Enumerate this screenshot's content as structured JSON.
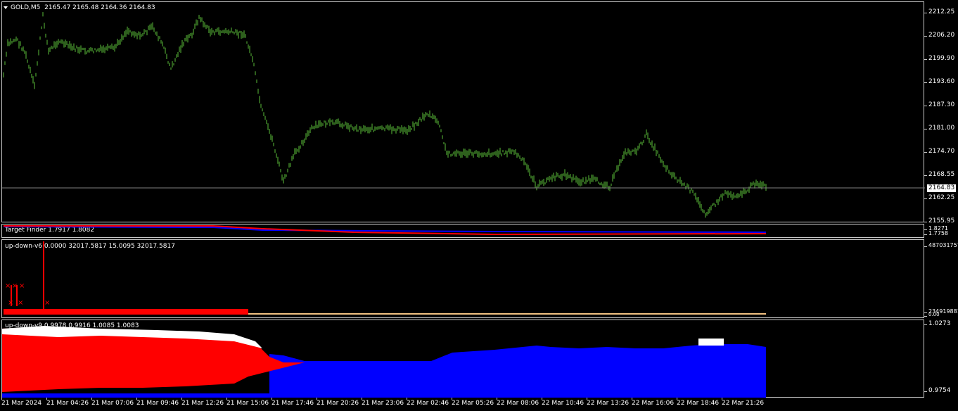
{
  "main": {
    "symbol_label": "GOLD,M5",
    "ohlc": "2165.47 2165.48 2164.36 2164.83",
    "price_tag": "2164.83",
    "price_ticks": [
      "2212.25",
      "2206.20",
      "2199.90",
      "2193.60",
      "2187.30",
      "2181.00",
      "2174.70",
      "2168.55",
      "2162.25",
      "2155.95"
    ],
    "colors": {
      "candles": "#5bbf3a",
      "bid_line": "#808080"
    }
  },
  "target_finder": {
    "label": "Target Finder 1.7917 1.8082",
    "ticks": [
      "1.8271",
      "1.7758"
    ],
    "colors": {
      "line_a": "#ff0000",
      "line_b": "#0000ff"
    }
  },
  "updown6": {
    "label": "up-down-v6 0.0000 32017.5817 15.0095 32017.5817",
    "ticks": [
      "487031757",
      "234919881",
      "0.00"
    ],
    "colors": {
      "signal": "#ff0000",
      "baseline": "#f0c080"
    }
  },
  "updown9": {
    "label": "up-down-v9 0.9978 0.9916 1.0085 1.0083",
    "ticks": [
      "1.0273",
      "0.9754"
    ],
    "colors": {
      "bull": "#0000ff",
      "bear": "#ff0000",
      "marker": "#ffffff"
    }
  },
  "time_axis": [
    "21 Mar 2024",
    "21 Mar 04:26",
    "21 Mar 07:06",
    "21 Mar 09:46",
    "21 Mar 12:26",
    "21 Mar 15:06",
    "21 Mar 17:46",
    "21 Mar 20:26",
    "21 Mar 23:06",
    "22 Mar 02:46",
    "22 Mar 05:26",
    "22 Mar 08:06",
    "22 Mar 10:46",
    "22 Mar 13:26",
    "22 Mar 16:06",
    "22 Mar 18:46",
    "22 Mar 21:26"
  ]
}
